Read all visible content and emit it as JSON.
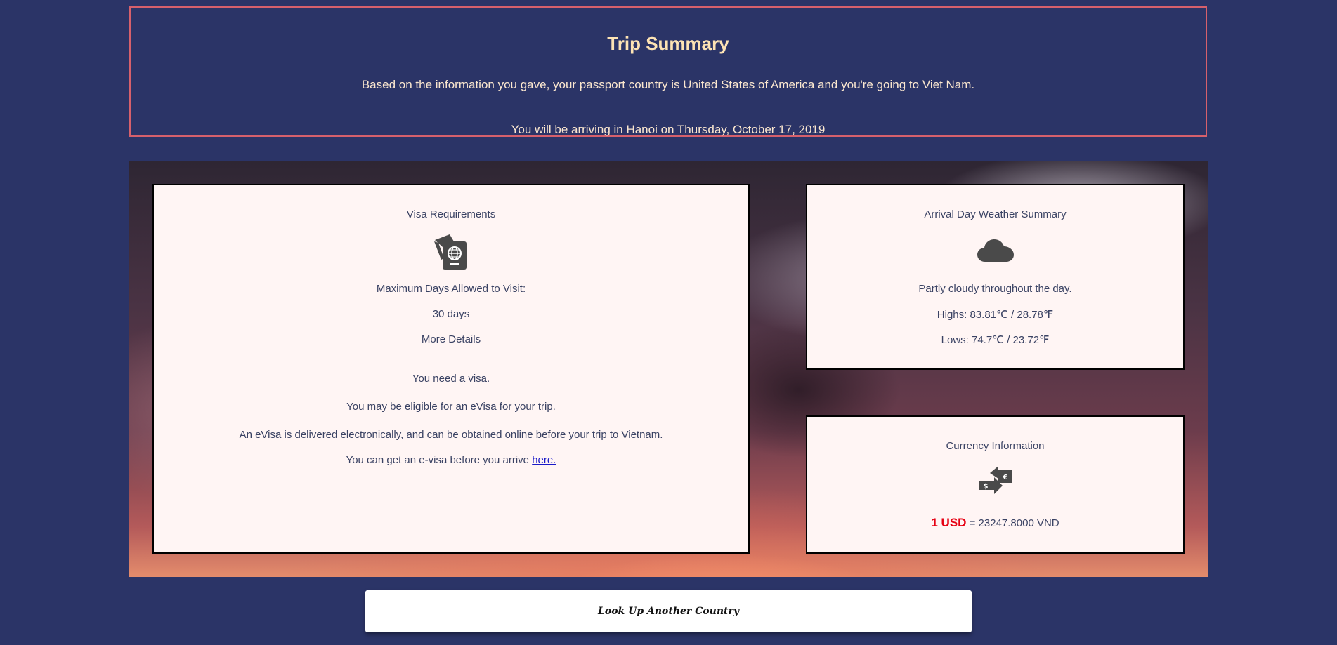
{
  "summary": {
    "title": "Trip Summary",
    "passport_line": "Based on the information you gave, your passport country is United States of America and you're going to Viet Nam.",
    "arrival_line": "You will be arriving in Hanoi on Thursday, October 17, 2019"
  },
  "visa": {
    "heading": "Visa Requirements",
    "icon": "passport-icon",
    "max_days_label": "Maximum Days Allowed to Visit:",
    "max_days_value": "30 days",
    "more_details": "More Details",
    "need_visa": "You need a visa.",
    "evisa_eligible": "You may be eligible for an eVisa for your trip.",
    "evisa_desc": "An eVisa is delivered electronically, and can be obtained online before your trip to Vietnam.",
    "evisa_prefix": "You can get an e-visa before you arrive",
    "evisa_link": "here."
  },
  "weather": {
    "heading": "Arrival Day Weather Summary",
    "icon": "cloud-icon",
    "summary": "Partly cloudy throughout the day.",
    "highs": "Highs: 83.81℃ / 28.78℉",
    "lows": "Lows: 74.7℃ / 23.72℉"
  },
  "currency": {
    "heading": "Currency Information",
    "icon": "currency-exchange-icon",
    "base": "1 USD",
    "rate": " = 23247.8000 VND"
  },
  "actions": {
    "lookup_label": "Look Up Another Country"
  },
  "colors": {
    "background": "#2b3467",
    "title": "#fde3b4",
    "summary_border": "#d6606c",
    "card_background": "#fff5f4",
    "usd_highlight": "#e60012",
    "link": "#1a1ac8"
  }
}
